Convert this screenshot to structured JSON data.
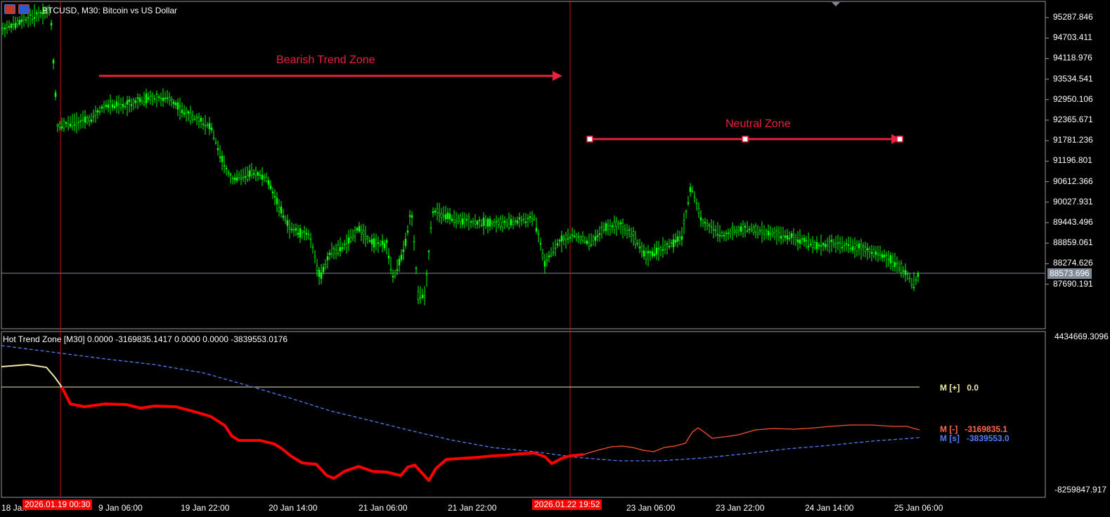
{
  "header": {
    "title": "BTCUSD, M30:  Bitcoin vs US Dollar",
    "icons": [
      "trade-panel-icon",
      "symbol-icon"
    ]
  },
  "price_axis": {
    "labels": [
      "95287.846",
      "94703.411",
      "94118.976",
      "93534.541",
      "92950.106",
      "92365.671",
      "91781.236",
      "91196.801",
      "90612.366",
      "90027.931",
      "89443.496",
      "88859.061",
      "88274.626",
      "87690.191"
    ],
    "current_price": "88573.696"
  },
  "indicator": {
    "title": "Hot Trend Zone [M30] 0.0000 -3169835.1417 0.0000 0.0000 -3839553.0176",
    "axis_top": "4434669.3096",
    "axis_bottom": "-8259847.917",
    "legend": [
      {
        "label": "M [+]",
        "value": "0.0",
        "color": "#f2e7a8"
      },
      {
        "label": "M [-]",
        "value": "-3169835.1",
        "color": "#ff6a4a"
      },
      {
        "label": "M [s]",
        "value": "-3839553.0",
        "color": "#4f7df2"
      }
    ]
  },
  "time_axis": {
    "labels": [
      "18 Jan",
      "9 Jan 06:00",
      "19 Jan 22:00",
      "20 Jan 14:00",
      "21 Jan 06:00",
      "21 Jan 22:00",
      "23 Jan 06:00",
      "23 Jan 22:00",
      "24 Jan 14:00",
      "25 Jan 06:00"
    ],
    "highlight_1": "2026.01.19 00:30",
    "highlight_2": "2026.01.22 19:52"
  },
  "zones": {
    "bearish": "Bearish Trend Zone",
    "neutral": "Neutral Zone"
  },
  "colors": {
    "candles": "#00ff00",
    "zone_line": "#e8213c",
    "vline": "#d01010",
    "grid": "#808080"
  }
}
